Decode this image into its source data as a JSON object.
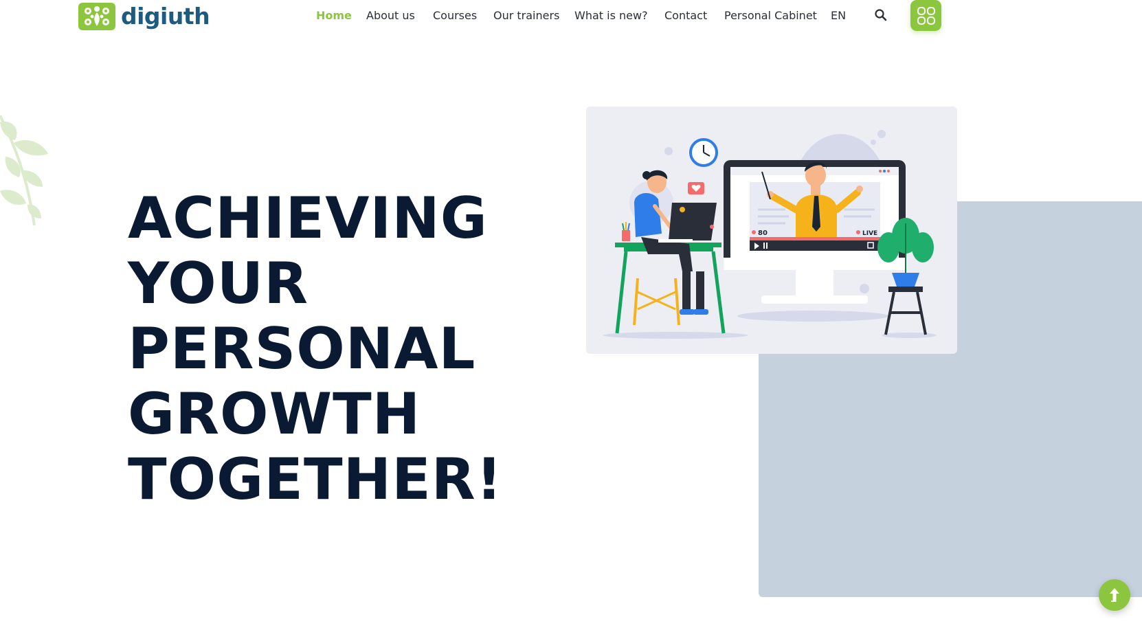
{
  "brand": {
    "name": "digiuth",
    "accent_color": "#8cc63f",
    "text_color": "#1d5b80"
  },
  "nav": {
    "items": [
      {
        "label": "Home",
        "active": true
      },
      {
        "label": "About us",
        "active": false
      },
      {
        "label": "Courses",
        "active": false
      },
      {
        "label": "Our trainers",
        "active": false
      },
      {
        "label": "What is new?",
        "active": false
      },
      {
        "label": "Contact",
        "active": false
      },
      {
        "label": "Personal Cabinet",
        "active": false
      },
      {
        "label": "EN",
        "active": false
      }
    ],
    "search_icon": "search-icon",
    "apps_icon": "grid-apps-icon"
  },
  "hero": {
    "title_lines": [
      "ACHIEVING",
      "YOUR",
      "PERSONAL",
      "GROWTH",
      "TOGETHER!"
    ],
    "title_color": "#0b1a33"
  },
  "illustration": {
    "viewer_count": "80",
    "live_label": "LIVE"
  },
  "scroll_top": {
    "icon": "arrow-up-icon"
  },
  "colors": {
    "gray_block": "#c6d1de",
    "illustration_bg": "#eceef4"
  }
}
